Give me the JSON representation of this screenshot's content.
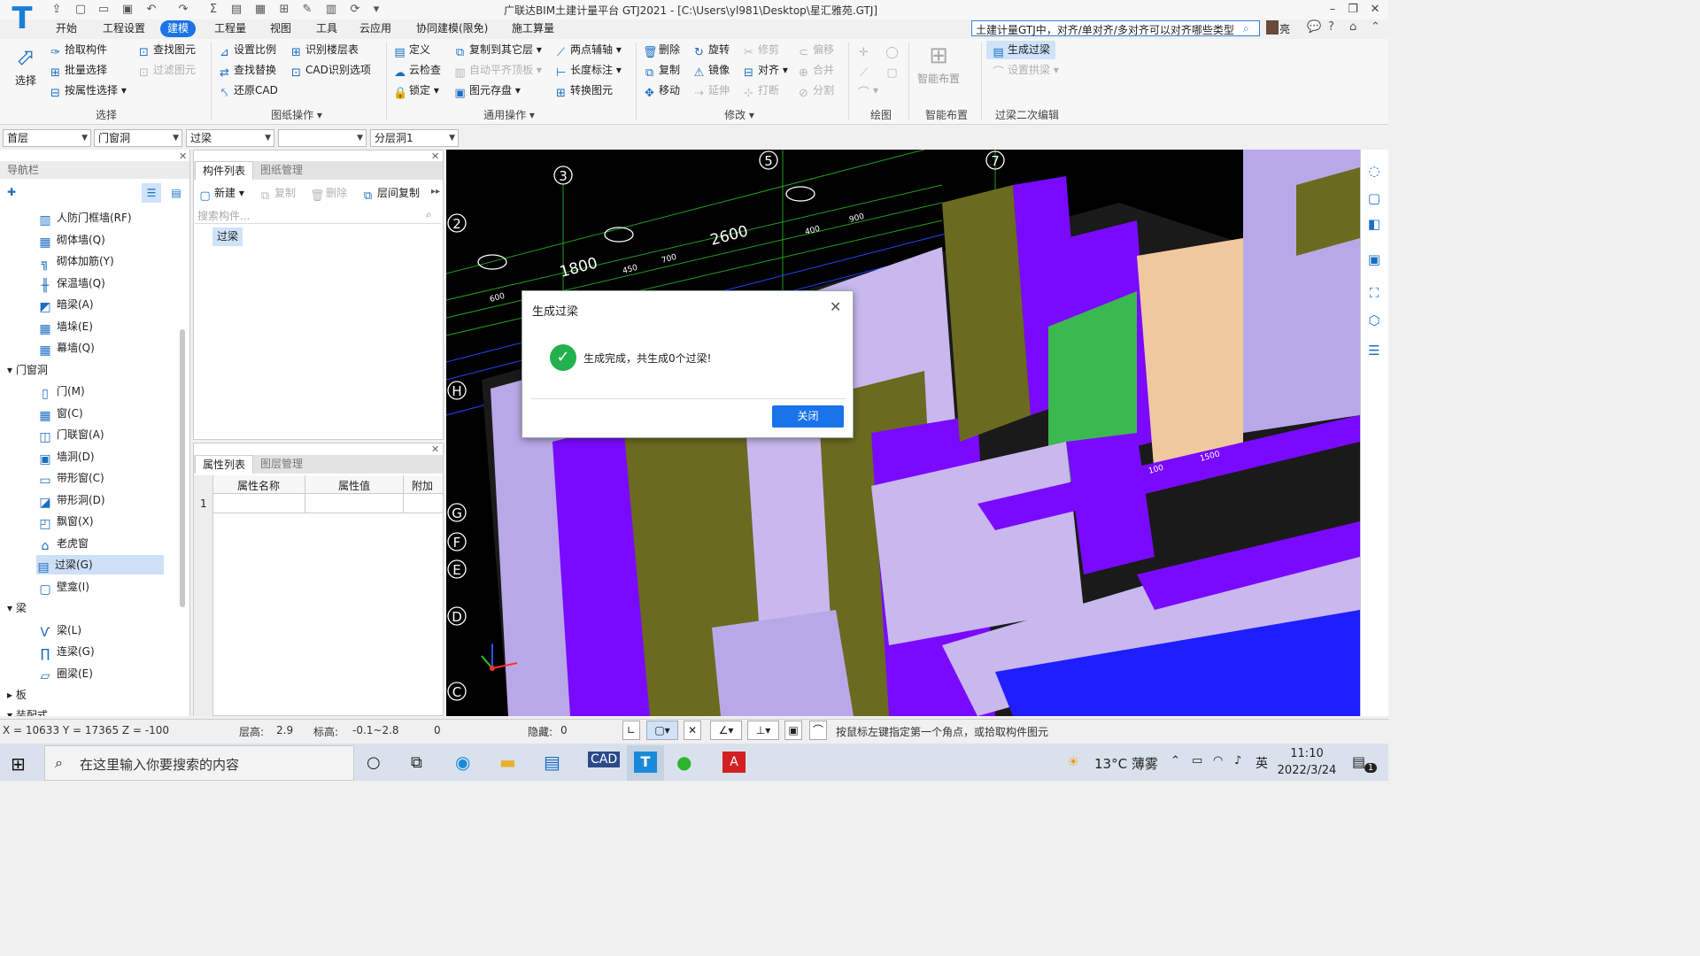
{
  "app": {
    "title": "广联达BIM土建计量平台 GTJ2021 - [C:\\Users\\yl981\\Desktop\\星汇雅苑.GTJ]",
    "search_placeholder": "土建计量GTJ中，对齐/单对齐/多对齐可以对齐哪些类型",
    "user_initial": "亮"
  },
  "menus": [
    "开始",
    "工程设置",
    "建模",
    "工程量",
    "视图",
    "工具",
    "云应用",
    "协同建模(限免)",
    "施工算量"
  ],
  "active_menu": "建模",
  "ribbon": {
    "select": {
      "big": "选择",
      "items": [
        "拾取构件",
        "批量选择",
        "按属性选择"
      ],
      "items2": [
        "查找图元",
        "过滤图元"
      ],
      "group": "选择"
    },
    "drawing": {
      "items": [
        "设置比例",
        "查找替换",
        "还原CAD"
      ],
      "items2": [
        "识别楼层表",
        "CAD识别选项"
      ],
      "group": "图纸操作"
    },
    "general": {
      "items": [
        "定义",
        "云检查",
        "锁定"
      ],
      "items2": [
        "复制到其它层",
        "自动平齐顶板",
        "图元存盘"
      ],
      "items3": [
        "两点辅轴",
        "长度标注",
        "转换图元"
      ],
      "group": "通用操作"
    },
    "modify": {
      "items": [
        "删除",
        "复制",
        "移动"
      ],
      "items2": [
        "旋转",
        "镜像",
        "延伸"
      ],
      "items3": [
        "修剪",
        "对齐",
        "打断"
      ],
      "items4": [
        "偏移",
        "合并",
        "分割"
      ],
      "group": "修改"
    },
    "draw": {
      "group": "绘图"
    },
    "smart": {
      "big": "智能布置",
      "group": "智能布置"
    },
    "lintel": {
      "items": [
        "生成过梁",
        "设置拱梁"
      ],
      "group": "过梁二次编辑"
    }
  },
  "filters": [
    "首层",
    "门窗洞",
    "过梁",
    "",
    "分层洞1"
  ],
  "nav": {
    "title": "导航栏",
    "items": [
      {
        "label": "人防门框墙(RF)",
        "icon": "▥"
      },
      {
        "label": "砌体墙(Q)",
        "icon": "▦"
      },
      {
        "label": "砌体加筋(Y)",
        "icon": "╗"
      },
      {
        "label": "保温墙(Q)",
        "icon": "╫"
      },
      {
        "label": "暗梁(A)",
        "icon": "◩"
      },
      {
        "label": "墙垛(E)",
        "icon": "▦"
      },
      {
        "label": "幕墙(Q)",
        "icon": "▦"
      }
    ],
    "group_door": "门窗洞",
    "door_items": [
      {
        "label": "门(M)",
        "icon": "▯"
      },
      {
        "label": "窗(C)",
        "icon": "▦"
      },
      {
        "label": "门联窗(A)",
        "icon": "◫"
      },
      {
        "label": "墙洞(D)",
        "icon": "▣"
      },
      {
        "label": "带形窗(C)",
        "icon": "▭"
      },
      {
        "label": "带形洞(D)",
        "icon": "◪"
      },
      {
        "label": "飘窗(X)",
        "icon": "◰"
      },
      {
        "label": "老虎窗",
        "icon": "⌂"
      },
      {
        "label": "过梁(G)",
        "icon": "▤"
      },
      {
        "label": "壁龛(I)",
        "icon": "▢"
      }
    ],
    "group_beam": "梁",
    "beam_items": [
      {
        "label": "梁(L)",
        "icon": "Ѵ"
      },
      {
        "label": "连梁(G)",
        "icon": "∏"
      },
      {
        "label": "圈梁(E)",
        "icon": "▱"
      }
    ],
    "group_slab": "板",
    "group_more": "装配式"
  },
  "comp": {
    "tab1": "构件列表",
    "tab2": "图纸管理",
    "new": "新建",
    "copy": "复制",
    "delete": "删除",
    "floorcopy": "层间复制",
    "search_placeholder": "搜索构件...",
    "item": "过梁"
  },
  "props": {
    "tab1": "属性列表",
    "tab2": "图层管理",
    "col1": "属性名称",
    "col2": "属性值",
    "col3": "附加",
    "row1": "1"
  },
  "axes": {
    "n3": "3",
    "n5": "5",
    "n7": "7",
    "n2": "2",
    "nH": "H",
    "nG": "G",
    "nF": "F",
    "nE": "E",
    "nD": "D",
    "nC": "C",
    "d1800": "1800",
    "d2600": "2600",
    "d600": "600",
    "d450": "450",
    "d700": "700",
    "d400": "400",
    "d900": "900",
    "d1500": "1500",
    "d100": "100"
  },
  "dialog": {
    "title": "生成过梁",
    "message": "生成完成，共生成0个过梁!",
    "close": "关闭"
  },
  "status": {
    "coords": "X = 10633 Y = 17365 Z = -100",
    "floor_h_label": "层高:",
    "floor_h": "2.9",
    "elev_label": "标高:",
    "elev": "-0.1~2.8",
    "zero": "0",
    "hidden_label": "隐藏:",
    "hidden": "0",
    "hint": "按鼠标左键指定第一个角点，或拾取构件图元"
  },
  "taskbar": {
    "search": "在这里输入你要搜索的内容",
    "weather": "13°C 薄雾",
    "ime": "英",
    "time": "11:10",
    "date": "2022/3/24",
    "notif": "1"
  }
}
